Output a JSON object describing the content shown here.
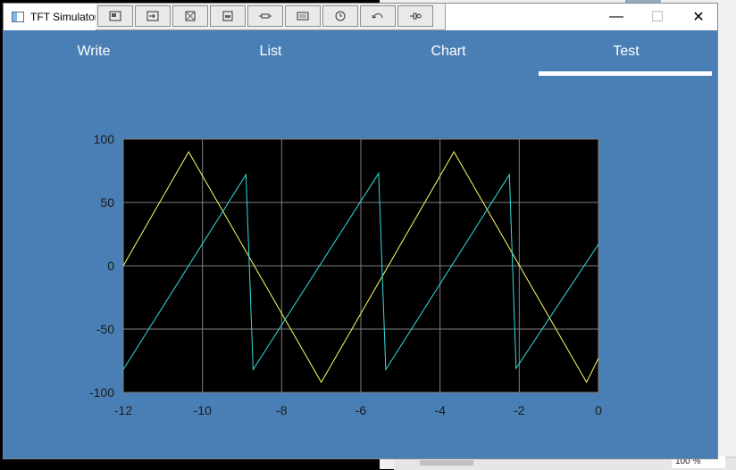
{
  "window": {
    "title": "TFT Simulator"
  },
  "window_controls": {
    "minimize": "—",
    "maximize": "☐",
    "close": "✕"
  },
  "toolbar": {
    "buttons": [
      "window-icon",
      "import-icon",
      "grid-icon",
      "panel-icon",
      "connector-icon",
      "keyboard-icon",
      "clock-icon",
      "undo-icon",
      "plug-icon"
    ]
  },
  "tabs": [
    {
      "label": "Write",
      "active": false
    },
    {
      "label": "List",
      "active": false
    },
    {
      "label": "Chart",
      "active": false
    },
    {
      "label": "Test",
      "active": true
    }
  ],
  "background_window": {
    "zoom": "100 %"
  },
  "colors": {
    "app_bg": "#4a7fb5",
    "plot_bg": "#000000",
    "grid": "#808080",
    "series1": "#ffff66",
    "series2": "#33dddd"
  },
  "chart_data": {
    "type": "line",
    "title": "",
    "xlabel": "",
    "ylabel": "",
    "xlim": [
      -12,
      0
    ],
    "ylim": [
      -100,
      100
    ],
    "xticks": [
      "-12",
      "-10",
      "-8",
      "-6",
      "-4",
      "-2",
      "0"
    ],
    "yticks": [
      "100",
      "50",
      "0",
      "-50",
      "-100"
    ],
    "grid": true,
    "series": [
      {
        "color": "#ffff66",
        "x": [
          -12,
          -10.35,
          -7.0,
          -3.65,
          -0.3,
          0
        ],
        "y": [
          0,
          90,
          -92,
          90,
          -92,
          -73
        ]
      },
      {
        "color": "#33dddd",
        "x": [
          -12,
          -8.9,
          -8.72,
          -5.55,
          -5.37,
          -2.25,
          -2.08,
          0
        ],
        "y": [
          -82,
          72,
          -82,
          73,
          -82,
          72,
          -81,
          17
        ]
      }
    ]
  }
}
